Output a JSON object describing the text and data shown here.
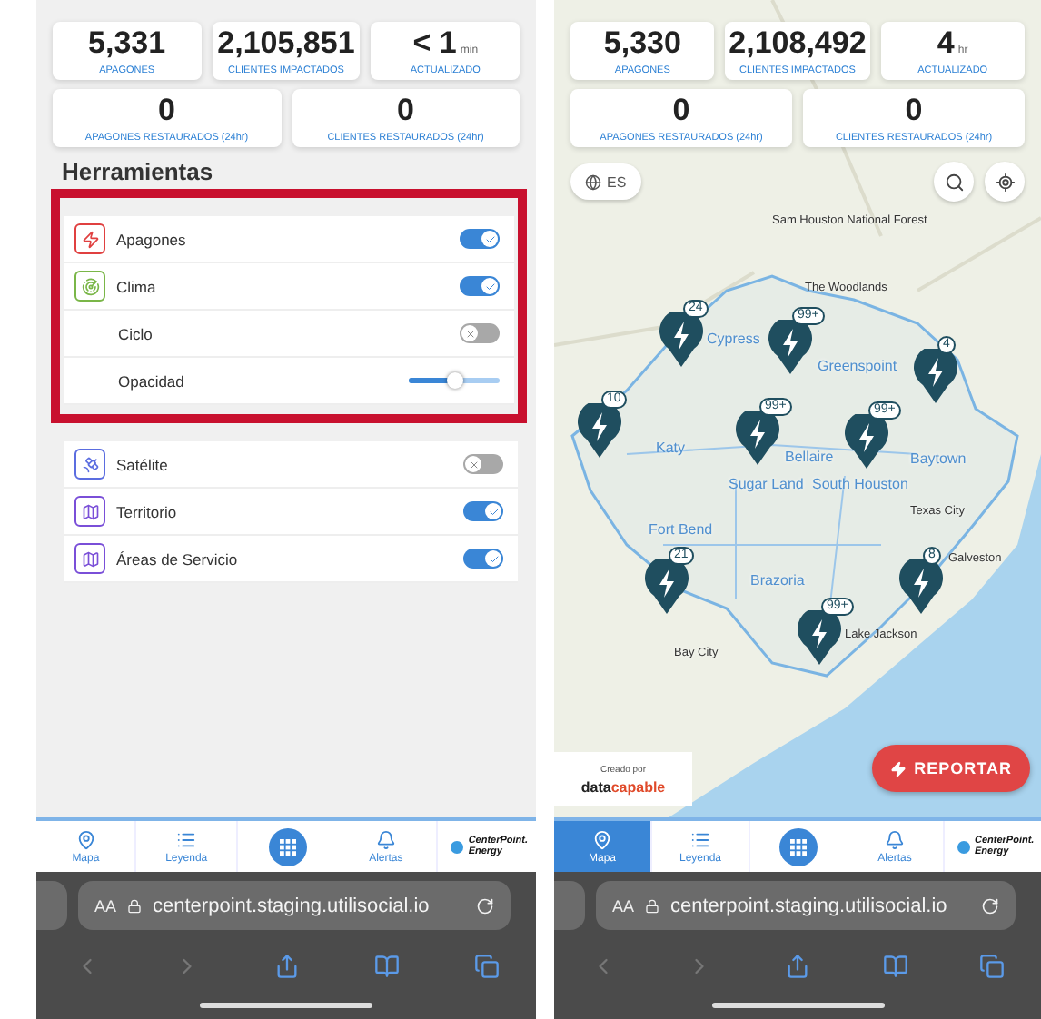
{
  "left_screen": {
    "stats": [
      {
        "value": "5,331",
        "label": "APAGONES"
      },
      {
        "value": "2,105,851",
        "label": "CLIENTES IMPACTADOS"
      },
      {
        "value": "< 1",
        "unit": "min",
        "label": "ACTUALIZADO"
      },
      {
        "value": "0",
        "label": "APAGONES RESTAURADOS (24hr)"
      },
      {
        "value": "0",
        "label": "CLIENTES RESTAURADOS (24hr)"
      }
    ],
    "tools": {
      "heading": "Herramientas",
      "groups": [
        {
          "highlighted": true,
          "items": [
            {
              "kind": "layer",
              "label": "Apagones",
              "on": true
            },
            {
              "kind": "layer",
              "label": "Clima",
              "on": true
            },
            {
              "kind": "sub_toggle",
              "label": "Ciclo",
              "on": false
            },
            {
              "kind": "slider",
              "label": "Opacidad",
              "level": 0.5
            }
          ]
        },
        {
          "highlighted": false,
          "items": [
            {
              "kind": "layer",
              "label": "Satélite",
              "on": false
            },
            {
              "kind": "layer",
              "label": "Territorio",
              "on": true
            },
            {
              "kind": "layer",
              "label": "Áreas de Servicio",
              "on": true
            }
          ]
        }
      ]
    },
    "nav": [
      {
        "kind": "tab",
        "label": "Mapa",
        "selected": false
      },
      {
        "kind": "tab",
        "label": "Leyenda",
        "selected": false
      },
      {
        "kind": "apps"
      },
      {
        "kind": "tab",
        "label": "Alertas",
        "selected": false
      },
      {
        "kind": "logo",
        "label": "CenterPoint. Energy"
      }
    ],
    "browser": {
      "text_size": "AA",
      "url": "centerpoint.staging.utilisocial.io",
      "can_go_back": false,
      "can_go_forward": false
    }
  },
  "right_screen": {
    "stats": [
      {
        "value": "5,330",
        "label": "APAGONES"
      },
      {
        "value": "2,108,492",
        "label": "CLIENTES IMPACTADOS"
      },
      {
        "value": "4",
        "unit": "hr",
        "label": "ACTUALIZADO"
      },
      {
        "value": "0",
        "label": "APAGONES RESTAURADOS (24hr)"
      },
      {
        "value": "0",
        "label": "CLIENTES RESTAURADOS (24hr)"
      }
    ],
    "language": "ES",
    "map": {
      "labels": [
        {
          "text": "Sam Houston National Forest",
          "kind": "place"
        },
        {
          "text": "The Woodlands",
          "kind": "place"
        },
        {
          "text": "Cypress",
          "kind": "area"
        },
        {
          "text": "Greenspoint",
          "kind": "area"
        },
        {
          "text": "Katy",
          "kind": "area"
        },
        {
          "text": "Baytown",
          "kind": "area"
        },
        {
          "text": "Bellaire",
          "kind": "area"
        },
        {
          "text": "Sugar Land",
          "kind": "area"
        },
        {
          "text": "South Houston",
          "kind": "area"
        },
        {
          "text": "Fort Bend",
          "kind": "area"
        },
        {
          "text": "Brazoria",
          "kind": "area"
        },
        {
          "text": "Texas City",
          "kind": "place"
        },
        {
          "text": "Galveston",
          "kind": "place"
        },
        {
          "text": "Lake Jackson",
          "kind": "place"
        },
        {
          "text": "Bay City",
          "kind": "place"
        }
      ],
      "clusters": [
        {
          "count": "24"
        },
        {
          "count": "99+"
        },
        {
          "count": "4"
        },
        {
          "count": "10"
        },
        {
          "count": "99+"
        },
        {
          "count": "99+"
        },
        {
          "count": "21"
        },
        {
          "count": "8"
        },
        {
          "count": "99+"
        }
      ]
    },
    "credit": {
      "caption": "Creado por",
      "logo_dark": "data",
      "logo_accent": "capable"
    },
    "report_button": "REPORTAR",
    "nav": [
      {
        "kind": "tab",
        "label": "Mapa",
        "selected": true
      },
      {
        "kind": "tab",
        "label": "Leyenda",
        "selected": false
      },
      {
        "kind": "apps"
      },
      {
        "kind": "tab",
        "label": "Alertas",
        "selected": false
      },
      {
        "kind": "logo",
        "label": "CenterPoint. Energy"
      }
    ],
    "browser": {
      "text_size": "AA",
      "url": "centerpoint.staging.utilisocial.io",
      "can_go_back": false,
      "can_go_forward": false
    }
  }
}
